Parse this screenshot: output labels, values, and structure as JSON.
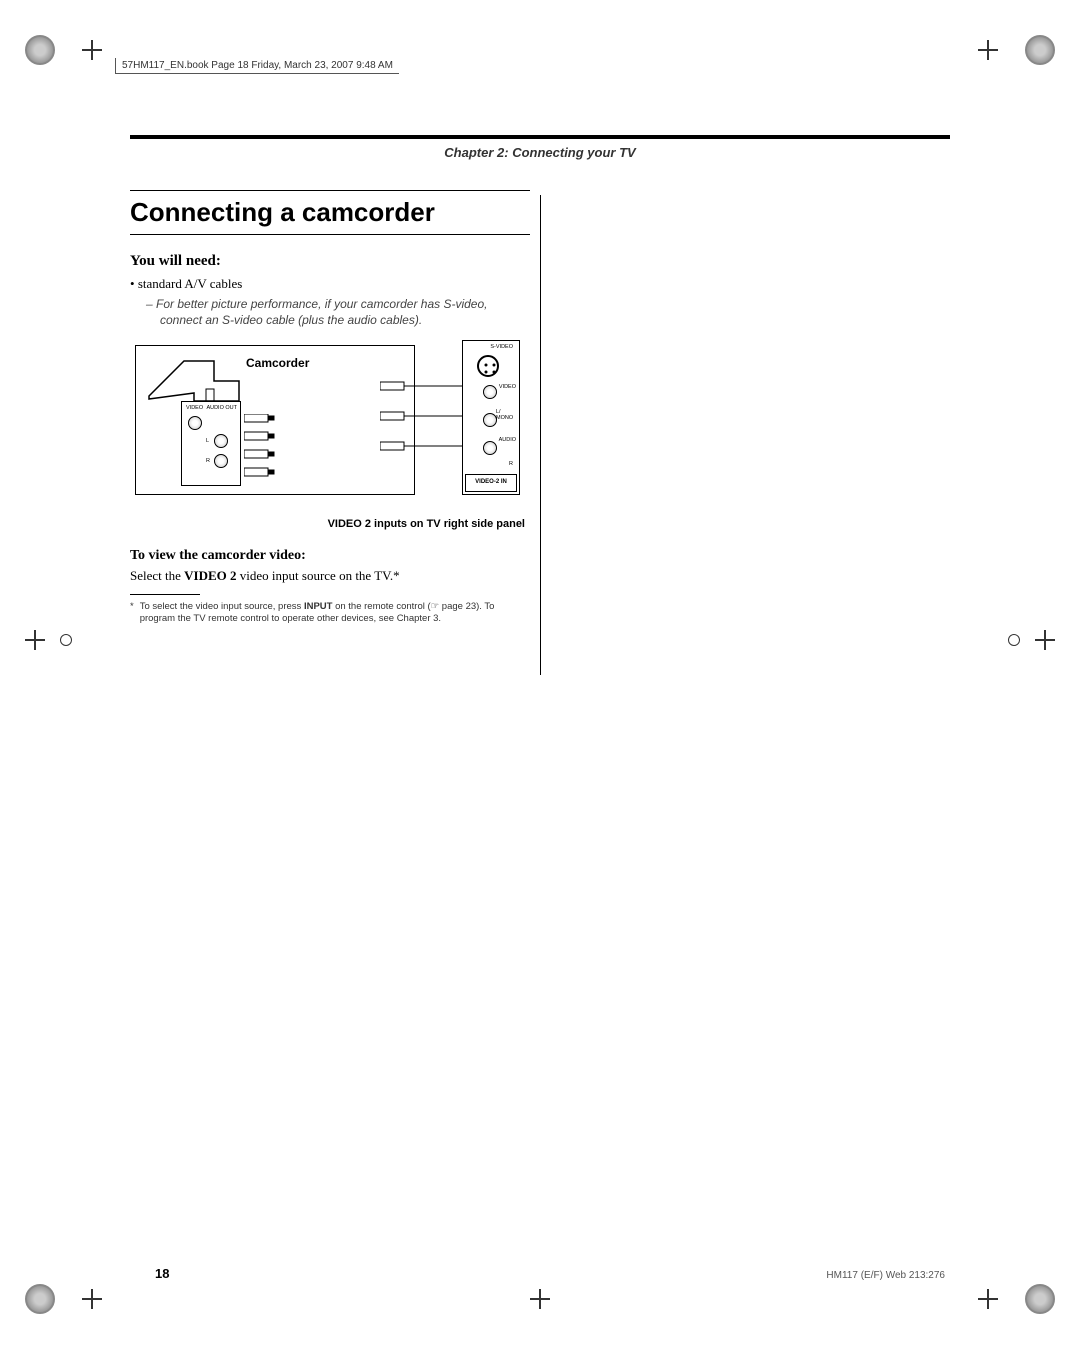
{
  "header_info": "57HM117_EN.book  Page 18  Friday, March 23, 2007  9:48 AM",
  "chapter_title": "Chapter 2: Connecting your TV",
  "section_heading": "Connecting a camcorder",
  "you_will_need": "You will need:",
  "bullet_1": "standard A/V cables",
  "sub_bullet_1": "For better picture performance, if your camcorder has S-video, connect an S-video cable (plus the audio cables).",
  "diagram": {
    "camcorder_label": "Camcorder",
    "port_video": "VIDEO",
    "port_audio_out": "AUDIO OUT",
    "port_l": "L",
    "port_r": "R",
    "tv_svideo": "S-VIDEO",
    "tv_video": "VIDEO",
    "tv_l_mono": "L/ MONO",
    "tv_audio": "AUDIO",
    "tv_r": "R",
    "tv_panel_label": "VIDEO-2 IN"
  },
  "diagram_caption": "VIDEO 2 inputs on TV right side panel",
  "view_heading": "To view the camcorder video:",
  "view_text_prefix": "Select the ",
  "view_text_bold": "VIDEO 2",
  "view_text_suffix": " video input source on the TV.*",
  "footnote_marker": "*",
  "footnote_prefix": "To select the video input source, press ",
  "footnote_bold": "INPUT",
  "footnote_suffix": " on the remote control (☞ page 23). To program the TV remote control to operate other devices, see Chapter 3.",
  "page_number": "18",
  "footer_right": "HM117 (E/F) Web 213:276"
}
